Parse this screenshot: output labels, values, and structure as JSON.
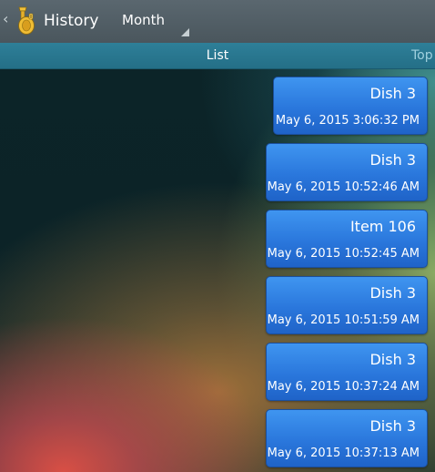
{
  "header": {
    "up_glyph": "‹",
    "app_icon": "tuba-icon",
    "title": "History",
    "period_selected": "Month"
  },
  "tabs": {
    "current": "List",
    "next": "Top"
  },
  "messages": [
    {
      "title": "Dish 3",
      "time": "May 6, 2015 3:06:32 PM"
    },
    {
      "title": "Dish 3",
      "time": "May 6, 2015 10:52:46 AM"
    },
    {
      "title": "Item 106",
      "time": "May 6, 2015 10:52:45 AM"
    },
    {
      "title": "Dish 3",
      "time": "May 6, 2015 10:51:59 AM"
    },
    {
      "title": "Dish 3",
      "time": "May 6, 2015 10:37:24 AM"
    },
    {
      "title": "Dish 3",
      "time": "May 6, 2015 10:37:13 AM"
    }
  ],
  "colors": {
    "actionbar": "#4f5b62",
    "tabstrip": "#2a7891",
    "bubble": "#2f80e3"
  }
}
